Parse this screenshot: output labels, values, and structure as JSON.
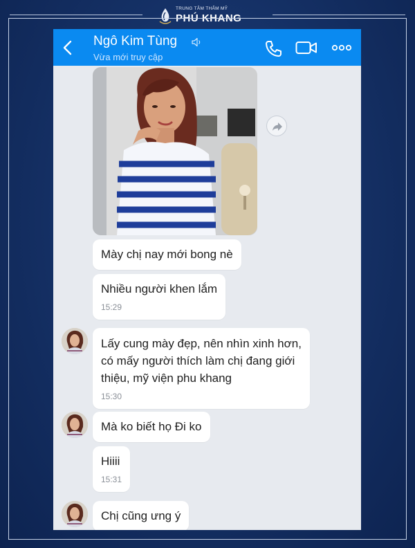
{
  "brand": {
    "subtitle": "TRUNG TÂM THẨM MỸ",
    "name": "PHÚ KHANG"
  },
  "header": {
    "contact_name": "Ngô Kim Tùng",
    "status": "Vừa mới truy cập",
    "icons": [
      "back-arrow-icon",
      "speaker-icon",
      "phone-icon",
      "video-camera-icon",
      "more-dots-icon"
    ]
  },
  "messages": [
    {
      "text": "Mày chị nay mới bong nè"
    },
    {
      "text": "Nhiều người  khen lắm",
      "time": "15:29"
    },
    {
      "lines": [
        "Lấy cung mày đẹp, nên nhìn xinh hơn,",
        "có mấy người thích làm chị đang giới",
        "thiệu,  mỹ  viện phu khang"
      ],
      "time": "15:30"
    },
    {
      "text": "Mà ko biết họ Đi ko"
    },
    {
      "text": "Hiiii",
      "time": "15:31"
    },
    {
      "text": "Chị cũng ưng ý"
    }
  ],
  "colors": {
    "header_blue": "#0a8af1",
    "chat_background": "#e7eaef",
    "bubble": "#ffffff",
    "page_navy": "#142f63"
  }
}
